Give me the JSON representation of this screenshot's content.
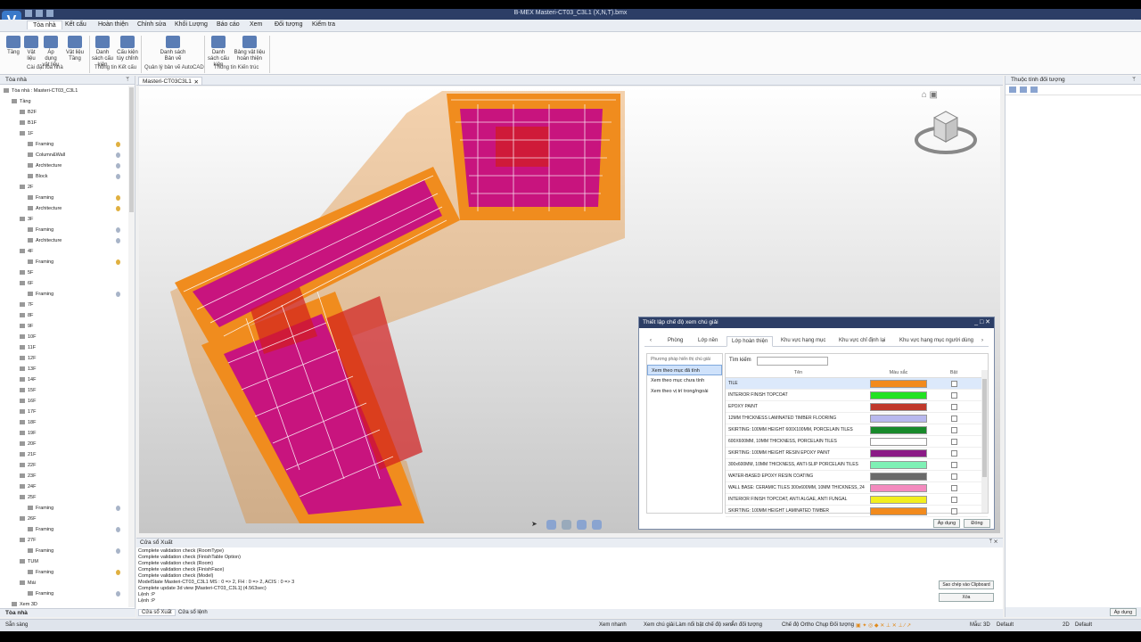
{
  "window": {
    "title": "B-MEX Masteri-CT03_C3L1 (X,N,T).bmx",
    "controls": [
      "_",
      "□",
      "✕"
    ]
  },
  "menu": {
    "tabs": [
      "Tòa nhà",
      "Kết cấu",
      "Hoàn thiện",
      "Chỉnh sửa",
      "Khối Lượng",
      "Báo cáo",
      "Xem",
      "Đối tượng",
      "Kiểm tra"
    ]
  },
  "ribbon": {
    "buttons": [
      "Tầng",
      "Vật liệu",
      "Áp dụng vật liệu",
      "Vật liệu Tầng",
      "Danh sách cấu kiện",
      "Cấu kiện tùy chỉnh",
      "Danh sách Bản vẽ",
      "Danh sách cấu kiện",
      "Bảng vật liệu hoàn thiện"
    ],
    "groups": [
      "Cài đặt tòa nhà",
      "Thông tin Kết cấu",
      "Quản lý bản vẽ AutoCAD",
      "Thông tin Kiến trúc"
    ]
  },
  "left_panel": {
    "title": "Tòa nhà",
    "pin": "ᛘ",
    "tree": [
      {
        "label": "Tòa nhà : Masteri-CT03_C3L1",
        "indent": 0,
        "bulb": ""
      },
      {
        "label": "Tầng",
        "indent": 1,
        "bulb": ""
      },
      {
        "label": "B2F",
        "indent": 2,
        "bulb": ""
      },
      {
        "label": "B1F",
        "indent": 2,
        "bulb": ""
      },
      {
        "label": "1F",
        "indent": 2,
        "bulb": ""
      },
      {
        "label": "Framing",
        "indent": 3,
        "bulb": "on"
      },
      {
        "label": "Column&Wall",
        "indent": 3,
        "bulb": "off"
      },
      {
        "label": "Architecture",
        "indent": 3,
        "bulb": "off"
      },
      {
        "label": "Block",
        "indent": 3,
        "bulb": "off"
      },
      {
        "label": "2F",
        "indent": 2,
        "bulb": ""
      },
      {
        "label": "Framing",
        "indent": 3,
        "bulb": "on"
      },
      {
        "label": "Architecture",
        "indent": 3,
        "bulb": "on"
      },
      {
        "label": "3F",
        "indent": 2,
        "bulb": ""
      },
      {
        "label": "Framing",
        "indent": 3,
        "bulb": "off"
      },
      {
        "label": "Architecture",
        "indent": 3,
        "bulb": "off"
      },
      {
        "label": "4F",
        "indent": 2,
        "bulb": ""
      },
      {
        "label": "Framing",
        "indent": 3,
        "bulb": "on"
      },
      {
        "label": "5F",
        "indent": 2,
        "bulb": ""
      },
      {
        "label": "6F",
        "indent": 2,
        "bulb": ""
      },
      {
        "label": "Framing",
        "indent": 3,
        "bulb": "off"
      },
      {
        "label": "7F",
        "indent": 2,
        "bulb": ""
      },
      {
        "label": "8F",
        "indent": 2,
        "bulb": ""
      },
      {
        "label": "9F",
        "indent": 2,
        "bulb": ""
      },
      {
        "label": "10F",
        "indent": 2,
        "bulb": ""
      },
      {
        "label": "11F",
        "indent": 2,
        "bulb": ""
      },
      {
        "label": "12F",
        "indent": 2,
        "bulb": ""
      },
      {
        "label": "13F",
        "indent": 2,
        "bulb": ""
      },
      {
        "label": "14F",
        "indent": 2,
        "bulb": ""
      },
      {
        "label": "15F",
        "indent": 2,
        "bulb": ""
      },
      {
        "label": "16F",
        "indent": 2,
        "bulb": ""
      },
      {
        "label": "17F",
        "indent": 2,
        "bulb": ""
      },
      {
        "label": "18F",
        "indent": 2,
        "bulb": ""
      },
      {
        "label": "19F",
        "indent": 2,
        "bulb": ""
      },
      {
        "label": "20F",
        "indent": 2,
        "bulb": ""
      },
      {
        "label": "21F",
        "indent": 2,
        "bulb": ""
      },
      {
        "label": "22F",
        "indent": 2,
        "bulb": ""
      },
      {
        "label": "23F",
        "indent": 2,
        "bulb": ""
      },
      {
        "label": "24F",
        "indent": 2,
        "bulb": ""
      },
      {
        "label": "25F",
        "indent": 2,
        "bulb": ""
      },
      {
        "label": "Framing",
        "indent": 3,
        "bulb": "off"
      },
      {
        "label": "26F",
        "indent": 2,
        "bulb": ""
      },
      {
        "label": "Framing",
        "indent": 3,
        "bulb": "off"
      },
      {
        "label": "27F",
        "indent": 2,
        "bulb": ""
      },
      {
        "label": "Framing",
        "indent": 3,
        "bulb": "off"
      },
      {
        "label": "TUM",
        "indent": 2,
        "bulb": ""
      },
      {
        "label": "Framing",
        "indent": 3,
        "bulb": "on"
      },
      {
        "label": "Mái",
        "indent": 2,
        "bulb": ""
      },
      {
        "label": "Framing",
        "indent": 3,
        "bulb": "off"
      },
      {
        "label": "Xem 3D",
        "indent": 1,
        "bulb": ""
      }
    ],
    "bottom_tab": "Tòa nhà"
  },
  "document": {
    "tab_label": "Masteri-CT03C3L1",
    "tab_close": "✕"
  },
  "dialog": {
    "title": "Thiết lập chế độ xem chú giải",
    "tabs": [
      "Phòng",
      "Lớp nền",
      "Lớp hoàn thiện",
      "Khu vực hạng mục",
      "Khu vực chỉ định lại",
      "Khu vực hạng mục người dùng"
    ],
    "active_tab": 2,
    "method_label": "Phương pháp hiển thị chú giải",
    "options": [
      "Xem theo mục đã tính",
      "Xem theo mục chưa tính",
      "Xem theo vị trí trong/ngoài"
    ],
    "search_label": "Tìm kiếm",
    "search_value": "",
    "col_name": "Tên",
    "col_color": "Màu sắc",
    "col_on": "Bật",
    "rows": [
      {
        "name": "TILE",
        "color": "#f28a1c"
      },
      {
        "name": "INTERIOR FINISH TOPCOAT",
        "color": "#22e222"
      },
      {
        "name": "EPOXY PAINT",
        "color": "#c0392b"
      },
      {
        "name": "12MM THICKNESS LAMINATED TIMBER FLOORING",
        "color": "#b8b8ee"
      },
      {
        "name": "SKIRTING: 100MM HEIGHT 600X100MM, PORCELAIN TILES",
        "color": "#17892a"
      },
      {
        "name": "600X600MM, 10MM THICKNESS, PORCELAIN TILES",
        "color": "#ffffff"
      },
      {
        "name": "SKIRTING: 100MM HEIGHT RESIN EPOXY PAINT",
        "color": "#8b1a86"
      },
      {
        "name": "300x600MM, 10MM THICKNESS, ANTI-SLIP PORCELAIN TILES",
        "color": "#7ff0b5"
      },
      {
        "name": "WATER-BASED EPOXY RESIN COATING",
        "color": "#6a6a6a"
      },
      {
        "name": "WALL BASE: CERAMIC TILES 300x600MM, 10MM THICKNESS, 24",
        "color": "#f38abe"
      },
      {
        "name": "INTERIOR FINISH TOPCOAT, ANTI ALGAE, ANTI FUNGAL",
        "color": "#f2ee1e"
      },
      {
        "name": "SKIRTING: 100MM HEIGHT LAMINATED TIMBER",
        "color": "#f28a1c"
      }
    ],
    "apply": "Áp dụng",
    "close": "Đóng"
  },
  "output": {
    "title": "Cửa sổ Xuất",
    "lines": [
      "Complete validation check (RoomType)",
      "Complete validation check (FinishTable Option)",
      "Complete validation check (Room)",
      "Complete validation check (FinishFace)",
      "Complete validation check (Model)",
      "ModelState Masteri-CT03_C3L1 MS : 0 => 2, FH : 0 => 2, ACIS : 0 => 3",
      "Complete update 3d view [Masteri-CT03_C3L1] (4.563sec)",
      "Lệnh :P",
      "Lệnh :P"
    ],
    "copy_btn": "Sao chép vào Clipboard",
    "clear_btn": "Xóa",
    "tabs": [
      "Cửa sổ Xuất",
      "Cửa sổ lệnh"
    ]
  },
  "right_panel": {
    "title": "Thuộc tính đối tượng",
    "apply": "Áp dụng"
  },
  "status": {
    "ready": "Sẵn sàng",
    "items": [
      "Xem nhanh",
      "Xem chú giải",
      "Làm nổi bật chế độ xem",
      "Ẩn đối tượng",
      "Chế độ Ortho",
      "Chụp Đối tượng",
      "Mẫu: 3D",
      "Default",
      "2D",
      "Default"
    ]
  }
}
